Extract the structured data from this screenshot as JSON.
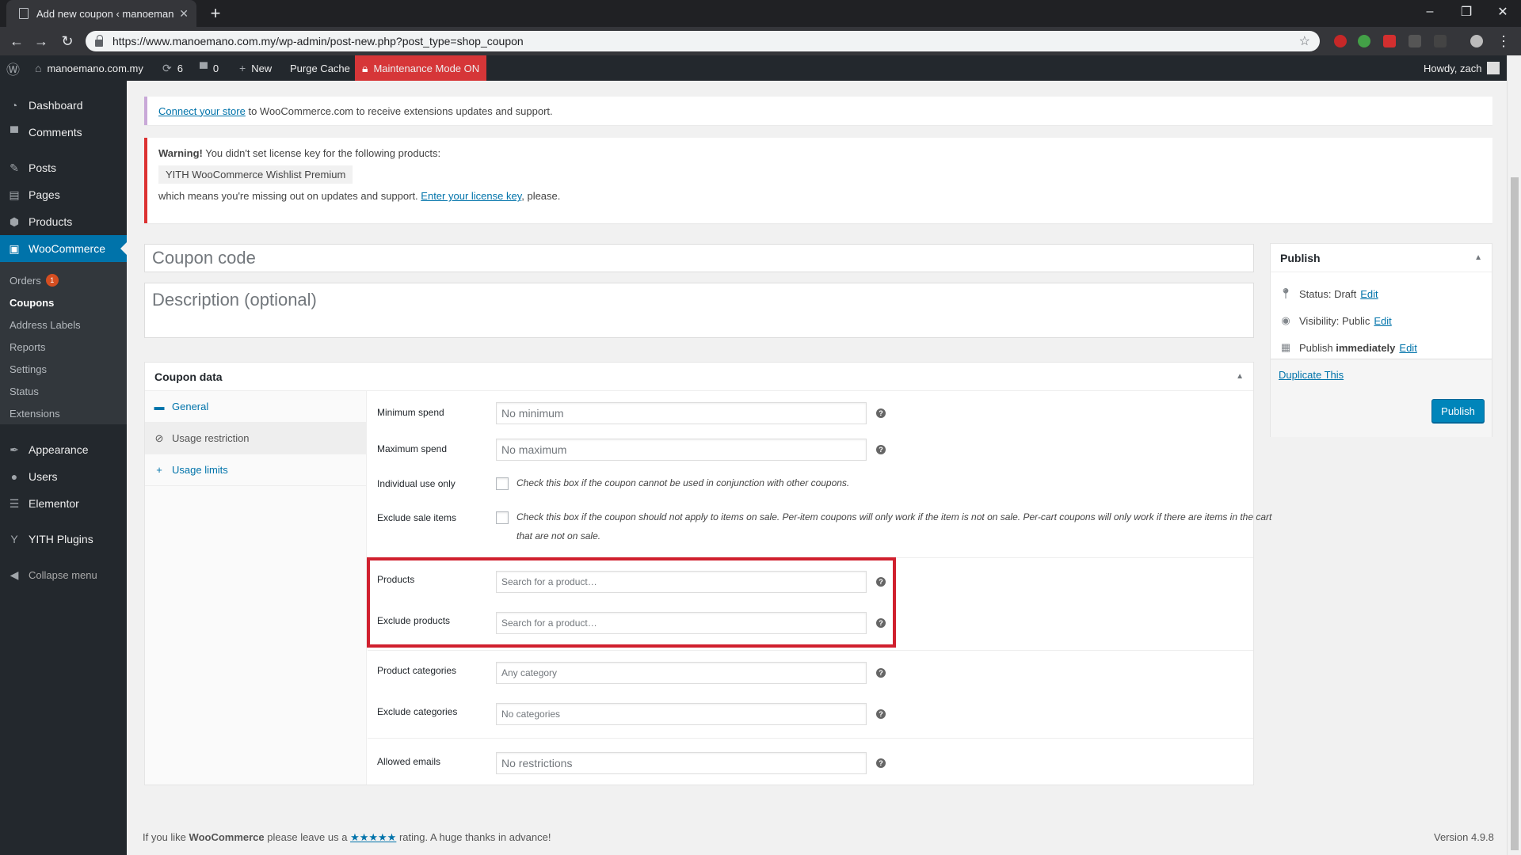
{
  "browser": {
    "tab_title": "Add new coupon ‹ manoemano…",
    "url": "https://www.manoemano.com.my/wp-admin/post-new.php?post_type=shop_coupon"
  },
  "adminbar": {
    "site_name": "manoemano.com.my",
    "updates_count": "6",
    "comments_count": "0",
    "new_label": "New",
    "purge_cache": "Purge Cache",
    "maintenance": "Maintenance Mode ON",
    "howdy": "Howdy, zach"
  },
  "sidebar": {
    "items": [
      {
        "label": "Dashboard",
        "icon": "dashboard-icon"
      },
      {
        "label": "Comments",
        "icon": "comment-icon"
      },
      {
        "label": "Posts",
        "icon": "pin-icon"
      },
      {
        "label": "Pages",
        "icon": "page-icon"
      },
      {
        "label": "Products",
        "icon": "box-icon"
      },
      {
        "label": "WooCommerce",
        "icon": "woo-icon"
      },
      {
        "label": "Appearance",
        "icon": "brush-icon"
      },
      {
        "label": "Users",
        "icon": "user-icon"
      },
      {
        "label": "Elementor",
        "icon": "elementor-icon"
      },
      {
        "label": "YITH Plugins",
        "icon": "yith-icon"
      },
      {
        "label": "Collapse menu",
        "icon": "collapse-icon"
      }
    ],
    "submenu": {
      "orders": "Orders",
      "orders_badge": "1",
      "coupons": "Coupons",
      "address_labels": "Address Labels",
      "reports": "Reports",
      "settings": "Settings",
      "status": "Status",
      "extensions": "Extensions"
    }
  },
  "notices": {
    "connect_link": "Connect your store",
    "connect_text": " to WooCommerce.com to receive extensions updates and support.",
    "warning_bold": "Warning!",
    "warning_text": " You didn't set license key for the following products:",
    "plugin_name": "YITH WooCommerce Wishlist Premium",
    "missing_text": "which means you're missing out on updates and support. ",
    "license_link": "Enter your license key",
    "please": ", please."
  },
  "editor": {
    "title_placeholder": "Coupon code",
    "desc_placeholder": "Description (optional)"
  },
  "coupon_data": {
    "title": "Coupon data",
    "tabs": [
      "General",
      "Usage restriction",
      "Usage limits"
    ],
    "fields": {
      "min_spend_label": "Minimum spend",
      "min_spend_placeholder": "No minimum",
      "max_spend_label": "Maximum spend",
      "max_spend_placeholder": "No maximum",
      "individual_label": "Individual use only",
      "individual_desc": "Check this box if the coupon cannot be used in conjunction with other coupons.",
      "exclude_sale_label": "Exclude sale items",
      "exclude_sale_desc": "Check this box if the coupon should not apply to items on sale. Per-item coupons will only work if the item is not on sale. Per-cart coupons will only work if there are items in the cart that are not on sale.",
      "products_label": "Products",
      "products_placeholder": "Search for a product…",
      "exclude_products_label": "Exclude products",
      "exclude_products_placeholder": "Search for a product…",
      "categories_label": "Product categories",
      "categories_placeholder": "Any category",
      "exclude_categories_label": "Exclude categories",
      "exclude_categories_placeholder": "No categories",
      "emails_label": "Allowed emails",
      "emails_placeholder": "No restrictions"
    }
  },
  "publish": {
    "title": "Publish",
    "status_label": "Status: ",
    "status_value": "Draft",
    "visibility_label": "Visibility: ",
    "visibility_value": "Public",
    "publish_label": "Publish ",
    "publish_value": "immediately",
    "edit": "Edit",
    "duplicate": "Duplicate This",
    "button": "Publish"
  },
  "footer": {
    "prefix": "If you like ",
    "brand": "WooCommerce",
    "middle": " please leave us a ",
    "stars": "★★★★★",
    "suffix": " rating. A huge thanks in advance!",
    "version": "Version 4.9.8"
  },
  "colors": {
    "accent": "#0073aa",
    "adminbar": "#23282d",
    "maintenance": "#d63638",
    "highlight": "#d0202e"
  }
}
